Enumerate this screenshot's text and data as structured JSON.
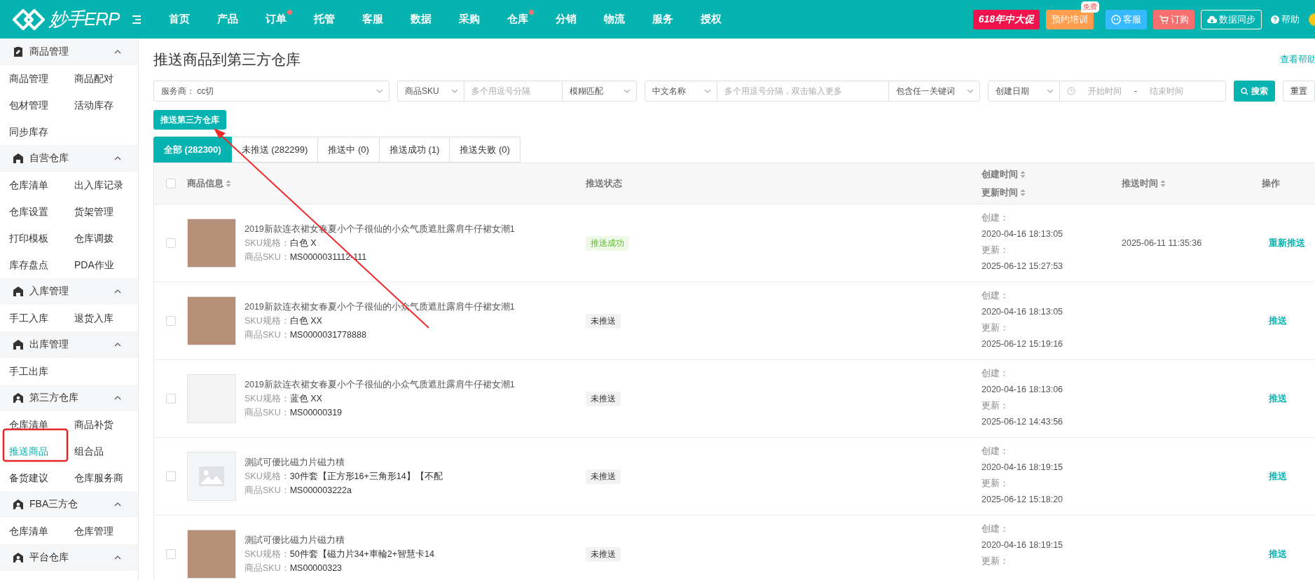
{
  "topbar": {
    "logo": "妙手ERP",
    "nav": [
      {
        "label": "首页",
        "dot": false
      },
      {
        "label": "产品",
        "dot": false
      },
      {
        "label": "订单",
        "dot": true
      },
      {
        "label": "托管",
        "dot": false
      },
      {
        "label": "客服",
        "dot": false
      },
      {
        "label": "数据",
        "dot": false
      },
      {
        "label": "采购",
        "dot": false
      },
      {
        "label": "仓库",
        "dot": true
      },
      {
        "label": "分销",
        "dot": false
      },
      {
        "label": "物流",
        "dot": false
      },
      {
        "label": "服务",
        "dot": false
      },
      {
        "label": "授权",
        "dot": false
      }
    ],
    "actions": [
      {
        "kind": "promo",
        "label": "618年中大促"
      },
      {
        "kind": "training",
        "label": "预约培训",
        "badge": "免费"
      },
      {
        "kind": "service",
        "label": "客服"
      },
      {
        "kind": "order",
        "label": "订购"
      },
      {
        "kind": "sync",
        "label": "数据同步"
      },
      {
        "kind": "help",
        "label": "帮助"
      }
    ]
  },
  "sidebar": {
    "sections": [
      {
        "title": "商品管理",
        "kind": "clipboard",
        "expanded": true,
        "items": [
          {
            "label": "商品管理",
            "selected": false
          },
          {
            "label": "商品配对",
            "selected": false
          },
          {
            "label": "包材管理",
            "selected": false
          },
          {
            "label": "活动库存",
            "selected": false
          },
          {
            "label": "同步库存",
            "selected": false
          }
        ]
      },
      {
        "title": "自营仓库",
        "kind": "house",
        "expanded": true,
        "items": [
          {
            "label": "仓库清单",
            "selected": false
          },
          {
            "label": "出入库记录",
            "selected": false
          },
          {
            "label": "仓库设置",
            "selected": false
          },
          {
            "label": "货架管理",
            "selected": false
          },
          {
            "label": "打印模板",
            "selected": false
          },
          {
            "label": "仓库调拨",
            "selected": false
          },
          {
            "label": "库存盘点",
            "selected": false
          },
          {
            "label": "PDA作业",
            "selected": false
          }
        ]
      },
      {
        "title": "入库管理",
        "kind": "house",
        "expanded": true,
        "items": [
          {
            "label": "手工入库",
            "selected": false
          },
          {
            "label": "退货入库",
            "selected": false
          }
        ]
      },
      {
        "title": "出库管理",
        "kind": "house",
        "expanded": true,
        "items": [
          {
            "label": "手工出库",
            "selected": false
          }
        ]
      },
      {
        "title": "第三方仓库",
        "kind": "tenant",
        "expanded": true,
        "items": [
          {
            "label": "仓库清单",
            "selected": false
          },
          {
            "label": "商品补货",
            "selected": false
          },
          {
            "label": "推送商品",
            "selected": true
          },
          {
            "label": "组合品",
            "selected": false
          },
          {
            "label": "备货建议",
            "selected": false
          },
          {
            "label": "仓库服务商",
            "selected": false
          }
        ]
      },
      {
        "title": "FBA三方仓",
        "kind": "tenant",
        "expanded": true,
        "items": [
          {
            "label": "仓库清单",
            "selected": false
          },
          {
            "label": "仓库管理",
            "selected": false
          }
        ]
      },
      {
        "title": "平台仓库",
        "kind": "tenant",
        "expanded": true
      }
    ]
  },
  "page": {
    "title": "推送商品到第三方仓库",
    "help_link": "查看帮助"
  },
  "filters": {
    "provider": {
      "label": "服务商：",
      "value": "cc切"
    },
    "sku": {
      "field": "商品SKU",
      "placeholder": "多个用逗号分隔",
      "match": "模糊匹配"
    },
    "name": {
      "field": "中文名称",
      "placeholder": "多个用逗号分隔，双击输入更多",
      "match": "包含任一关键词"
    },
    "date": {
      "field": "创建日期",
      "start_placeholder": "开始时间",
      "separator": "-",
      "end_placeholder": "结束时间"
    },
    "search": "搜索",
    "reset": "重置"
  },
  "push_button": "推送第三方仓库",
  "tabs": [
    {
      "label": "全部 (282300)",
      "selected": true
    },
    {
      "label": "未推送 (282299)",
      "selected": false
    },
    {
      "label": "推送中 (0)",
      "selected": false
    },
    {
      "label": "推送成功 (1)",
      "selected": false
    },
    {
      "label": "推送失败 (0)",
      "selected": false
    }
  ],
  "table": {
    "select_all": {
      "checked": false
    },
    "columns": [
      {
        "labels": [
          "商品信息"
        ],
        "sortable": true
      },
      {
        "labels": [
          "推送状态"
        ],
        "sortable": false
      },
      {
        "labels": [
          "创建时间",
          "更新时间"
        ],
        "sortable": true
      },
      {
        "labels": [
          "推送时间"
        ],
        "sortable": true
      },
      {
        "labels": [
          "操作"
        ],
        "sortable": false
      }
    ],
    "rows": [
      {
        "checked": false,
        "kind": "photo",
        "title": "2019新款连衣裙女春夏小个子很仙的小众气质遮肚露肩牛仔裙女潮1",
        "spec_label": "SKU规格：",
        "spec": "白色 X",
        "sku_label": "商品SKU：",
        "sku": "MS0000031112-111",
        "status": {
          "kind": "success",
          "label": "推送成功"
        },
        "created_label": "创建：",
        "created": "2020-04-16 18:13:05",
        "updated_label": "更新：",
        "updated": "2025-06-12 15:27:53",
        "push_time": "2025-06-11 11:35:36",
        "action": "重新推送"
      },
      {
        "checked": false,
        "kind": "photo",
        "title": "2019新款连衣裙女春夏小个子很仙的小众气质遮肚露肩牛仔裙女潮1",
        "spec_label": "SKU规格：",
        "spec": "白色 XX",
        "sku_label": "商品SKU：",
        "sku": "MS0000031778888",
        "status": {
          "kind": "pending",
          "label": "未推送"
        },
        "created_label": "创建：",
        "created": "2020-04-16 18:13:05",
        "updated_label": "更新：",
        "updated": "2025-06-12 15:19:16",
        "action": "推送"
      },
      {
        "checked": false,
        "kind": "illustration",
        "title": "2019新款连衣裙女春夏小个子很仙的小众气质遮肚露肩牛仔裙女潮1",
        "spec_label": "SKU规格：",
        "spec": "蓝色 XX",
        "sku_label": "商品SKU：",
        "sku": "MS00000319",
        "status": {
          "kind": "pending",
          "label": "未推送"
        },
        "created_label": "创建：",
        "created": "2020-04-16 18:13:06",
        "updated_label": "更新：",
        "updated": "2025-06-12 14:43:56",
        "action": "推送"
      },
      {
        "checked": false,
        "kind": "placeholder",
        "title": "測試可優比磁力片磁力積",
        "spec_label": "SKU规格：",
        "spec": "30件套【正方形16+三角形14】【不配",
        "sku_label": "商品SKU：",
        "sku": "MS000003222a",
        "status": {
          "kind": "pending",
          "label": "未推送"
        },
        "created_label": "创建：",
        "created": "2020-04-16 18:19:15",
        "updated_label": "更新：",
        "updated": "2025-06-12 15:18:20",
        "action": "推送"
      },
      {
        "checked": false,
        "kind": "photo",
        "title": "測試可優比磁力片磁力積",
        "spec_label": "SKU规格：",
        "spec": "50件套【磁力片34+車輪2+智慧卡14",
        "sku_label": "商品SKU：",
        "sku": "MS00000323",
        "status": {
          "kind": "pending",
          "label": "未推送"
        },
        "created_label": "创建：",
        "created": "2020-04-16 18:19:15",
        "updated_label": "更新：",
        "action": "推送"
      }
    ]
  }
}
